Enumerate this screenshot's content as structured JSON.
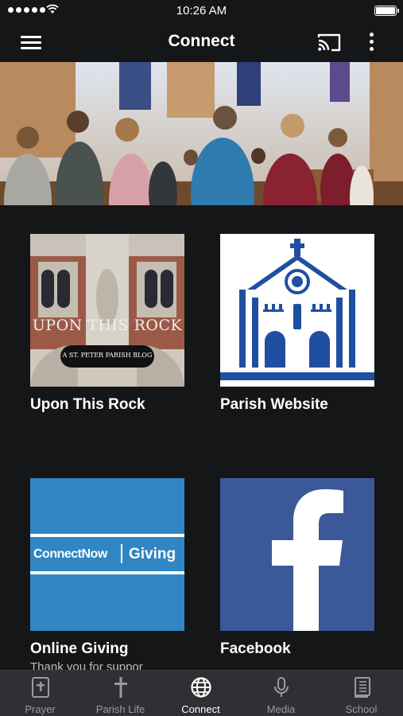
{
  "status_bar": {
    "time": "10:26 AM",
    "signal_icon": "cellular-signal-icon",
    "wifi_icon": "wifi-icon",
    "battery_icon": "battery-icon",
    "battery_level": 1.0
  },
  "header": {
    "title": "Connect",
    "menu_icon": "hamburger-menu-icon",
    "cast_icon": "cast-icon",
    "more_icon": "more-vertical-icon"
  },
  "hero": {
    "image": "congregation-standing-in-church-photo"
  },
  "tiles": [
    {
      "label": "Upon This Rock",
      "thumb_title": "UPON THIS ROCK",
      "thumb_badge": "A ST. PETER PARISH BLOG"
    },
    {
      "label": "Parish Website",
      "thumb_icon": "church-building-icon"
    },
    {
      "label": "Online Giving",
      "sublabel": "Thank you for suppor",
      "thumb_brand_left": "ConnectNow",
      "thumb_brand_right": "Giving"
    },
    {
      "label": "Facebook",
      "thumb_icon": "facebook-logo-icon"
    }
  ],
  "tab_bar": {
    "active": "Connect",
    "tabs": [
      {
        "label": "Prayer",
        "icon": "bible-book-icon"
      },
      {
        "label": "Parish Life",
        "icon": "cross-icon"
      },
      {
        "label": "Connect",
        "icon": "globe-icon"
      },
      {
        "label": "Media",
        "icon": "microphone-icon"
      },
      {
        "label": "School",
        "icon": "school-book-icon"
      }
    ]
  },
  "colors": {
    "background": "#151618",
    "tab_bar": "#2f3033",
    "parish_blue": "#1f4fa0",
    "giving_blue": "#2f86c2",
    "facebook_blue": "#3b5998",
    "tab_inactive": "#9a9b9e"
  }
}
